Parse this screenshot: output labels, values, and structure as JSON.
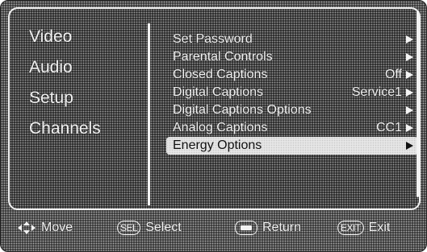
{
  "left_menu": {
    "items": [
      {
        "label": "Video"
      },
      {
        "label": "Audio"
      },
      {
        "label": "Setup"
      },
      {
        "label": "Channels"
      }
    ]
  },
  "right_menu": {
    "items": [
      {
        "label": "Set Password",
        "value": "",
        "arrow": true
      },
      {
        "label": "Parental Controls",
        "value": "",
        "arrow": true
      },
      {
        "label": "Closed Captions",
        "value": "Off",
        "arrow": true
      },
      {
        "label": "Digital Captions",
        "value": "Service1",
        "arrow": true
      },
      {
        "label": "Digital Captions Options",
        "value": "",
        "arrow": true
      },
      {
        "label": "Analog Captions",
        "value": "CC1",
        "arrow": true
      },
      {
        "label": "Energy Options",
        "value": "",
        "arrow": true,
        "selected": true
      }
    ]
  },
  "hints": {
    "move": {
      "icon": "navigation-arrows-icon",
      "label": "Move"
    },
    "select": {
      "key": "SEL",
      "label": "Select"
    },
    "return": {
      "icon": "return-key-icon",
      "label": "Return"
    },
    "exit": {
      "key": "EXIT",
      "label": "Exit"
    }
  },
  "colors": {
    "background": "#3a3a3a",
    "text": "#f4f4f4",
    "highlight": "#e6e6e6"
  }
}
